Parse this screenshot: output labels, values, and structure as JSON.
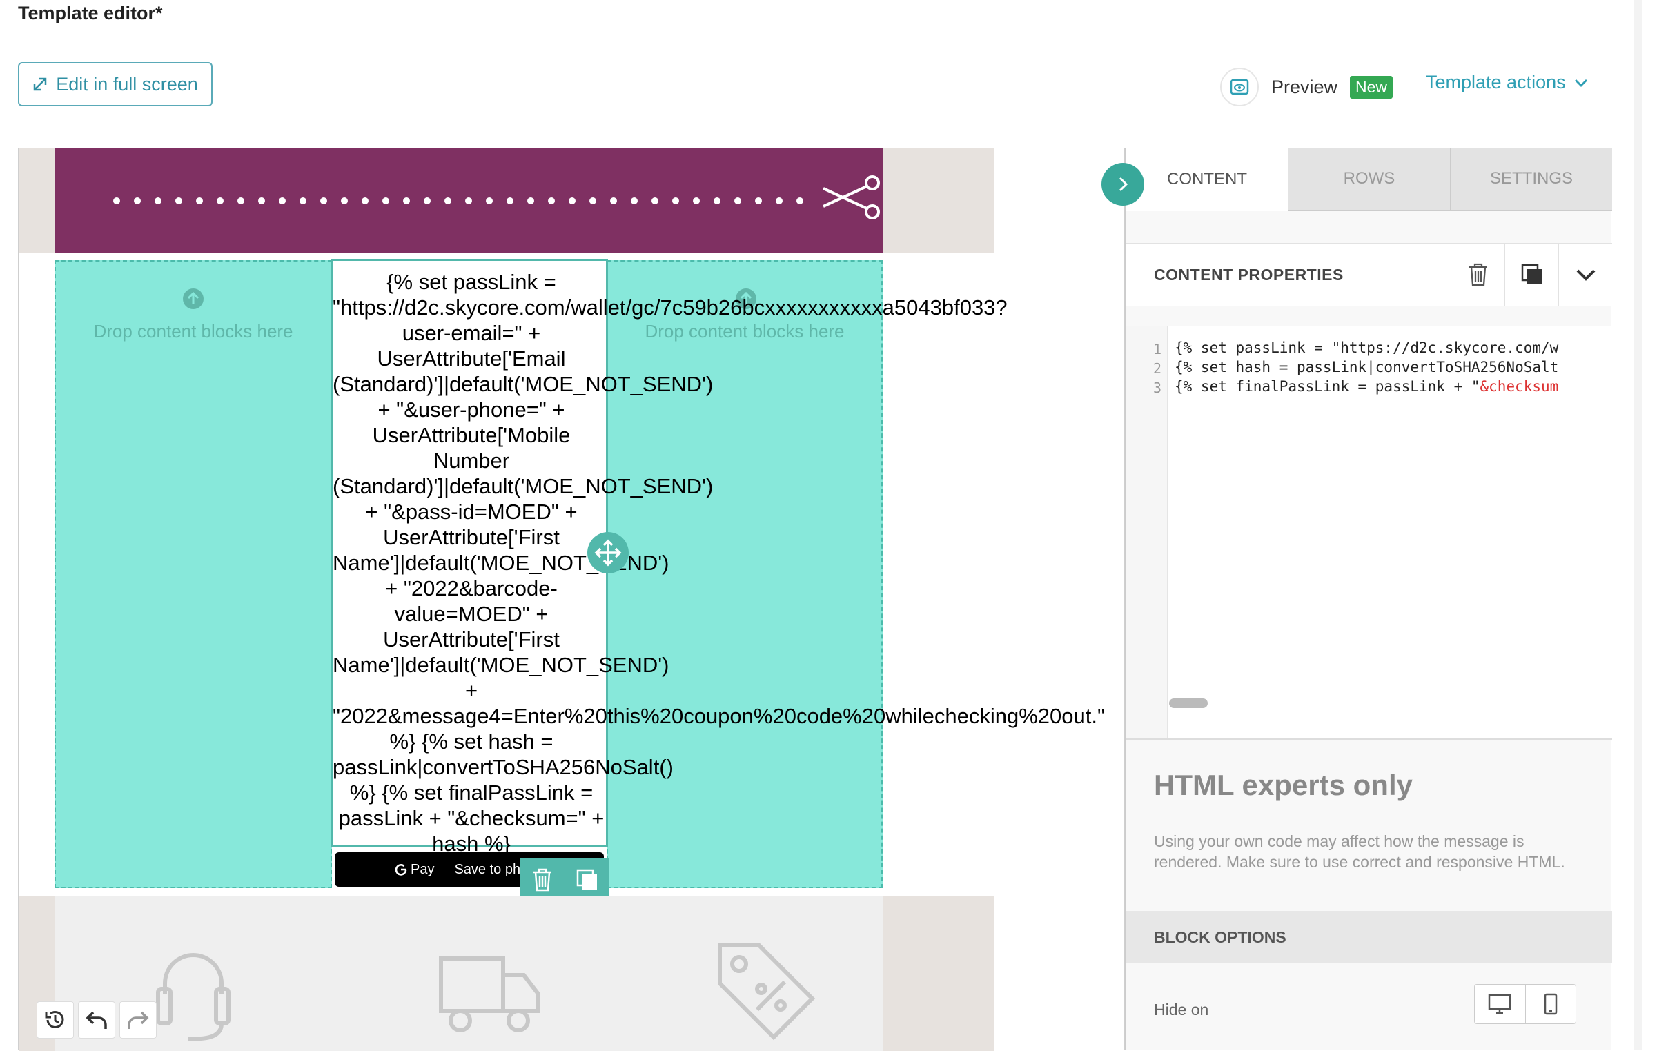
{
  "header": {
    "title": "Template editor*",
    "edit_full_screen": "Edit in full screen",
    "preview": "Preview",
    "new_badge": "New",
    "template_actions": "Template actions"
  },
  "canvas": {
    "drop_label_left": "Drop content blocks here",
    "drop_label_right": "Drop content blocks here",
    "html_block_text": "{% set passLink =\n\"https://d2c.skycore.com/wallet/gc/7c59b26bcxxxxxxxxxxxa5043bf033?\nuser-email=\" +\nUserAttribute['Email\n(Standard)']|default('MOE_NOT_SEND')\n+ \"&user-phone=\" +\nUserAttribute['Mobile\nNumber\n(Standard)']|default('MOE_NOT_SEND')\n+ \"&pass-id=MOED\" +\nUserAttribute['First\nName']|default('MOE_NOT_SEND')\n+ \"2022&barcode-\nvalue=MOED\" +\nUserAttribute['First\nName']|default('MOE_NOT_SEND')\n+\n\"2022&message4=Enter%20this%20coupon%20code%20whilechecking%20out.\"\n%} {% set hash =\npassLink|convertToSHA256NoSalt()\n%} {% set finalPassLink =\npassLink + \"&checksum=\" +\nhash %}",
    "gpay_pay": "Pay",
    "gpay_save": "Save to ph"
  },
  "panel": {
    "tabs": [
      {
        "label": "CONTENT",
        "active": true
      },
      {
        "label": "ROWS",
        "active": false
      },
      {
        "label": "SETTINGS",
        "active": false
      }
    ],
    "content_properties": "CONTENT PROPERTIES",
    "code_lines": [
      {
        "num": "1",
        "code": "{% set passLink = \"https://d2c.skycore.com/w",
        "str": ""
      },
      {
        "num": "2",
        "code": "{% set hash = passLink|convertToSHA256NoSalt",
        "str": ""
      },
      {
        "num": "3",
        "code": "{% set finalPassLink = passLink + \"",
        "str": "&checksum"
      }
    ],
    "experts_title": "HTML experts only",
    "experts_desc": "Using your own code may affect how the message is rendered. Make sure to use correct and responsive HTML.",
    "block_options": "BLOCK OPTIONS",
    "hide_on": "Hide on"
  },
  "colors": {
    "accent": "#2f9fb4",
    "banner": "#7f3062",
    "drop_zone": "#87e8da",
    "selection": "#52b8ab",
    "new_badge": "#34a853"
  },
  "icons": [
    "expand-icon",
    "preview-eye-icon",
    "chevron-down-icon",
    "scissors-icon",
    "upload-arrow-icon",
    "move-icon",
    "trash-icon",
    "duplicate-icon",
    "history-icon",
    "undo-icon",
    "redo-icon",
    "chevron-right-icon",
    "desktop-icon",
    "mobile-icon",
    "headset-icon",
    "truck-icon",
    "tag-icon",
    "google-g-icon"
  ]
}
